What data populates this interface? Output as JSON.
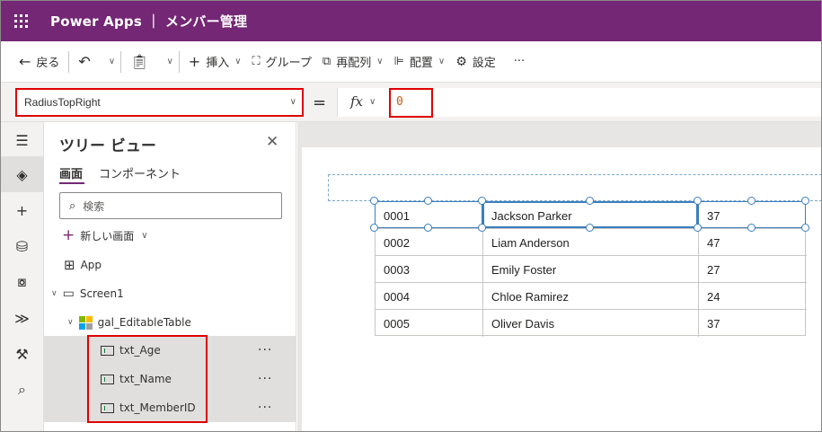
{
  "app": {
    "title": "Power Apps ｜ メンバー管理"
  },
  "toolbar": {
    "back_label": "戻る",
    "insert_label": "挿入",
    "group_label": "グループ",
    "reorder_label": "再配列",
    "align_label": "配置",
    "settings_label": "設定",
    "more_label": "···"
  },
  "formula": {
    "property": "RadiusTopRight",
    "equals": "=",
    "fx": "fx",
    "value": "0"
  },
  "tree": {
    "title": "ツリー ビュー",
    "tabs": [
      "画面",
      "コンポーネント"
    ],
    "active_tab": 0,
    "search_placeholder": "検索",
    "new_screen_label": "新しい画面",
    "nodes": {
      "app": "App",
      "screen": "Screen1",
      "gallery": "gal_EditableTable",
      "age": "txt_Age",
      "name": "txt_Name",
      "member_id": "txt_MemberID"
    },
    "more_label": "···"
  },
  "table": {
    "rows": [
      {
        "id": "0001",
        "name": "Jackson Parker",
        "age": "37"
      },
      {
        "id": "0002",
        "name": "Liam Anderson",
        "age": "47"
      },
      {
        "id": "0003",
        "name": "Emily Foster",
        "age": "27"
      },
      {
        "id": "0004",
        "name": "Chloe Ramirez",
        "age": "24"
      },
      {
        "id": "0005",
        "name": "Oliver Davis",
        "age": "37"
      }
    ]
  },
  "colors": {
    "brand": "#742774",
    "highlight": "#e00000",
    "selection": "#3b7ec0"
  }
}
